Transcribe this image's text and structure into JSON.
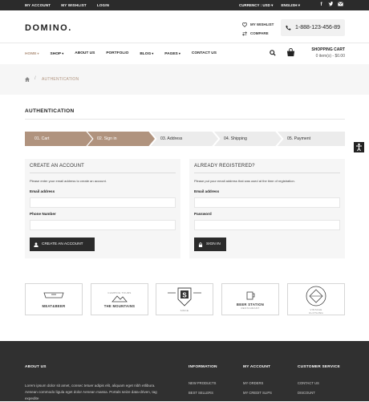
{
  "topbar": {
    "links": [
      "MY ACCOUNT",
      "MY WISHLIST",
      "LOGIN"
    ],
    "currency": "CURRENCY : USD",
    "language": "ENGLISH",
    "socials": [
      "f",
      "t",
      "mail"
    ]
  },
  "header": {
    "logo": "DOMINO.",
    "wishlist": "MY WISHLIST",
    "compare": "COMPARE",
    "phone": "1-888-123-456-89"
  },
  "nav": {
    "items": [
      "HOME",
      "SHOP",
      "ABOUT US",
      "PORTFOLIO",
      "BLOG",
      "PAGES",
      "CONTACT US"
    ],
    "cart_title": "SHOPPING CART",
    "cart_summary": "0 item(s) - $0.00"
  },
  "breadcrumb": {
    "current": "AUTHENTICATION",
    "separator": "/"
  },
  "page_title": "AUTHENTICATION",
  "steps": [
    "01. Cart",
    "02. Sign in",
    "03. Address",
    "04. Shipping",
    "05. Payment"
  ],
  "create_account": {
    "title": "CREATE AN ACCOUNT",
    "intro": "Please enter your email address to create an account.",
    "email_label": "Email address",
    "phone_label": "Phone Number",
    "button": "CREATE AN ACCOUNT"
  },
  "registered": {
    "title": "ALREADY REGISTERED?",
    "intro": "Please put your email address that was used at the time of registration.",
    "email_label": "Email address",
    "password_label": "Password",
    "button": "SIGN IN"
  },
  "brands": [
    {
      "name": "MEAT&BEER",
      "sub": ""
    },
    {
      "name": "THE MOUNTAINS",
      "sub": "CAMPING TOURS"
    },
    {
      "name": "S",
      "sub": "SINCE"
    },
    {
      "name": "BEER STATION",
      "sub": "RESTAURANT"
    },
    {
      "name": "VINTAGE",
      "sub": "CLOTHING"
    }
  ],
  "footer": {
    "about_title": "ABOUT US",
    "about_text": "Lorem ipsum dolor sit amet, consec tetuer adipis elit, aliquam eget nibh etlibura. Aenean commodo ligula eget dolor Aenean massa. Portals seize data-driven, tag expedite",
    "info_title": "INFORMATION",
    "info_links": [
      "NEW PRODUCTS",
      "BEST SELLERS"
    ],
    "account_title": "MY ACCOUNT",
    "account_links": [
      "MY ORDERS",
      "MY CREDIT SLIPS"
    ],
    "service_title": "CUSTOMER SERVICE",
    "service_links": [
      "CONTACT US",
      "DISCOUNT"
    ]
  },
  "colors": {
    "accent": "#b0937e",
    "dark": "#2b2b2b",
    "light_bg": "#f6f6f6"
  }
}
